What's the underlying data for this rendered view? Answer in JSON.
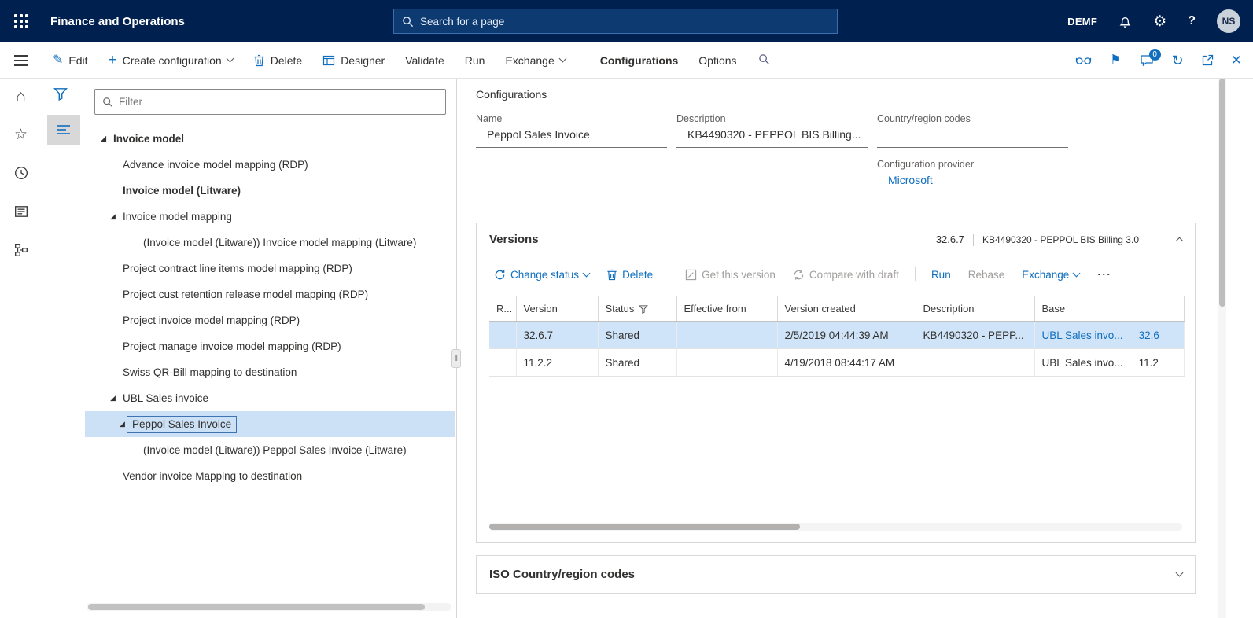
{
  "topbar": {
    "app_title": "Finance and Operations",
    "search_placeholder": "Search for a page",
    "company": "DEMF",
    "help_label": "?",
    "avatar_initials": "NS"
  },
  "action_bar": {
    "edit": "Edit",
    "create_configuration": "Create configuration",
    "delete": "Delete",
    "designer": "Designer",
    "validate": "Validate",
    "run": "Run",
    "exchange": "Exchange",
    "tab_configurations": "Configurations",
    "tab_options": "Options",
    "notification_badge": "0"
  },
  "tree": {
    "filter_placeholder": "Filter",
    "nodes": [
      {
        "label": "Invoice model"
      },
      {
        "label": "Advance invoice model mapping (RDP)"
      },
      {
        "label": "Invoice model (Litware)"
      },
      {
        "label": "Invoice model mapping"
      },
      {
        "label": "(Invoice model (Litware)) Invoice model mapping (Litware)"
      },
      {
        "label": "Project contract line items model mapping (RDP)"
      },
      {
        "label": "Project cust retention release model mapping (RDP)"
      },
      {
        "label": "Project invoice model mapping (RDP)"
      },
      {
        "label": "Project manage invoice model mapping (RDP)"
      },
      {
        "label": "Swiss QR-Bill mapping to destination"
      },
      {
        "label": "UBL Sales invoice"
      },
      {
        "label": "Peppol Sales Invoice"
      },
      {
        "label": "(Invoice model (Litware)) Peppol Sales Invoice (Litware)"
      },
      {
        "label": "Vendor invoice Mapping to destination"
      }
    ]
  },
  "details": {
    "title": "Configurations",
    "name_label": "Name",
    "name_value": "Peppol Sales Invoice",
    "description_label": "Description",
    "description_value": "KB4490320 - PEPPOL BIS Billing...",
    "country_label": "Country/region codes",
    "country_value": "",
    "provider_label": "Configuration provider",
    "provider_value": "Microsoft"
  },
  "versions": {
    "title": "Versions",
    "header_version": "32.6.7",
    "header_description": "KB4490320 - PEPPOL BIS Billing 3.0",
    "toolbar": {
      "change_status": "Change status",
      "delete": "Delete",
      "get_this_version": "Get this version",
      "compare_with_draft": "Compare with draft",
      "run": "Run",
      "rebase": "Rebase",
      "exchange": "Exchange"
    },
    "grid": {
      "columns": [
        "R...",
        "Version",
        "Status",
        "Effective from",
        "Version created",
        "Description",
        "Base"
      ],
      "rows": [
        {
          "version": "32.6.7",
          "status": "Shared",
          "effective_from": "",
          "version_created": "2/5/2019 04:44:39 AM",
          "description": "KB4490320 - PEPP...",
          "base": "UBL Sales invo...",
          "base_version": "32.6"
        },
        {
          "version": "11.2.2",
          "status": "Shared",
          "effective_from": "",
          "version_created": "4/19/2018 08:44:17 AM",
          "description": "",
          "base": "UBL Sales invo...",
          "base_version": "11.2"
        }
      ]
    }
  },
  "iso": {
    "title": "ISO Country/region codes"
  }
}
